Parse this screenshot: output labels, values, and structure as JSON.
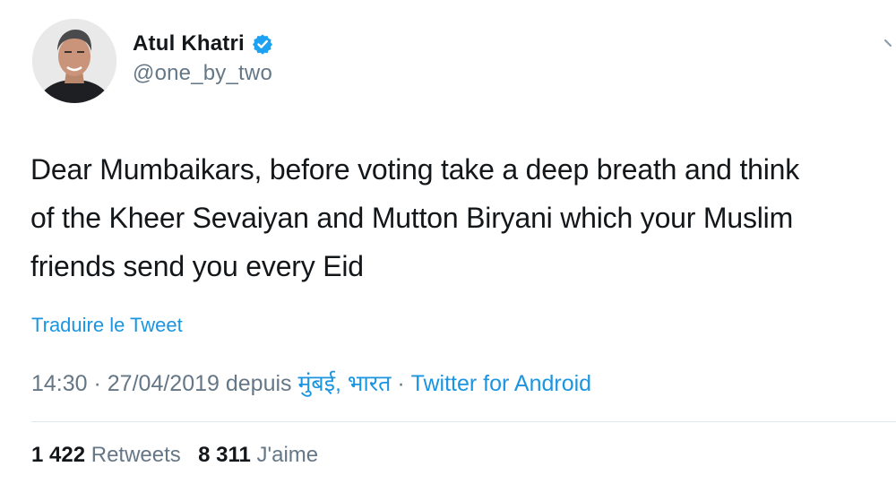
{
  "author": {
    "display_name": "Atul Khatri",
    "handle": "@one_by_two",
    "verified_icon": "verified-badge-icon",
    "avatar": "profile-photo"
  },
  "tweet": {
    "lines": [
      "Dear Mumbaikars, before voting take a deep breath and think",
      "of the Kheer Sevaiyan and Mutton Biryani which your Muslim",
      "friends send you every Eid"
    ],
    "translate_label": "Traduire le Tweet"
  },
  "meta": {
    "time": "14:30",
    "separator": " · ",
    "date": "27/04/2019",
    "from_label": " depuis ",
    "location": "मुंबई, भारत",
    "separator2": " · ",
    "source": "Twitter for Android"
  },
  "stats": {
    "retweets_count": "1 422",
    "retweets_label": "Retweets",
    "likes_count": "8 311",
    "likes_label": "J'aime"
  },
  "colors": {
    "link": "#1b95e0",
    "muted": "#657786",
    "text": "#14171a",
    "divider": "#e1e8ed"
  }
}
